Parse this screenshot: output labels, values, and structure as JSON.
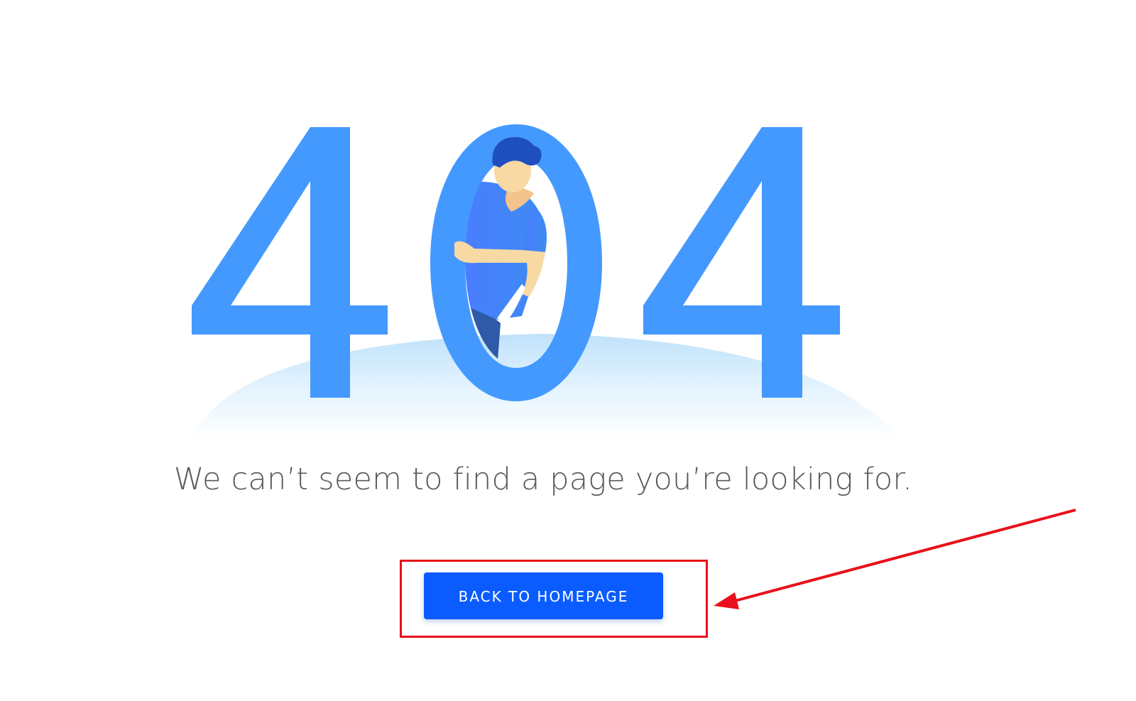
{
  "error": {
    "code_digit_1": "4",
    "code_digit_2": "0",
    "code_digit_3": "4",
    "message": "We can’t seem to find a page you’re looking for."
  },
  "actions": {
    "back_to_homepage_label": "BACK TO HOMEPAGE"
  },
  "icons": {
    "illustration": "person-peeking-through-zero-illustration",
    "annotation": "red-arrow-icon"
  },
  "colors": {
    "digits": "#4499ff",
    "button": "#0a5cff",
    "message_text": "#5a5a5a",
    "annotation": "#e8101a",
    "ground_glow": "#d6ecff"
  }
}
